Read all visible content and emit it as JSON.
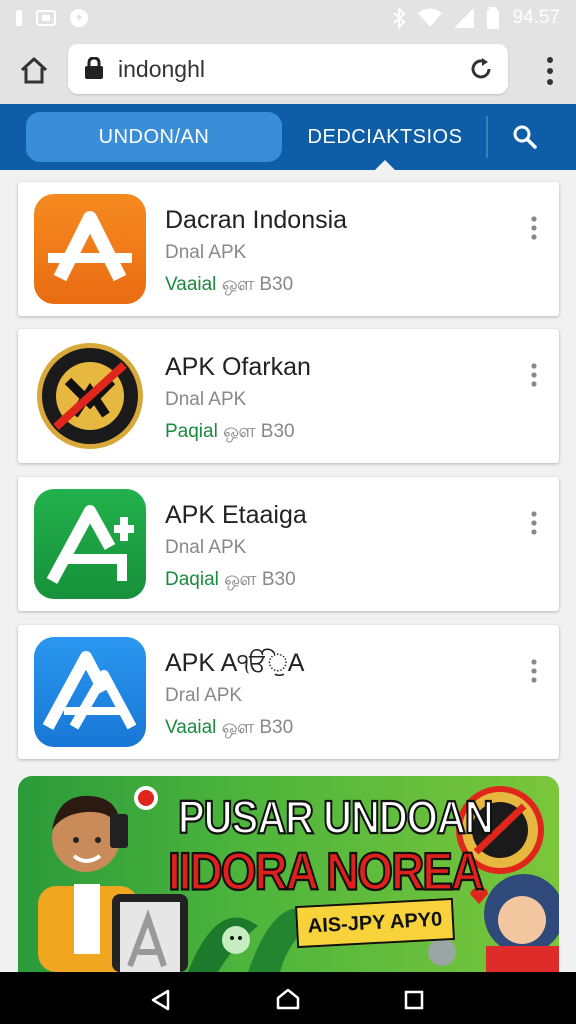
{
  "status_bar": {
    "time": "94.57"
  },
  "browser": {
    "url": "indonghl"
  },
  "tabs": {
    "active_label": "UNDON/AN",
    "second_label": "DEDCIAKTSIOS"
  },
  "apps": [
    {
      "title": "Dacran Indonsia",
      "subtitle": "Dnal APK",
      "status": "Vaaial",
      "size": "ஔ B30",
      "icon": "orange-a-icon",
      "color": "#f07818"
    },
    {
      "title": "APK Ofarkan",
      "subtitle": "Dnal APK",
      "status": "Paqial",
      "size": "ஔ B30",
      "icon": "badge-emblem-icon",
      "color": "#1a1a1a"
    },
    {
      "title": "APK Etaaiga",
      "subtitle": "Dnal APK",
      "status": "Daqial",
      "size": "ஔ B30",
      "icon": "green-a-icon",
      "color": "#1faa45"
    },
    {
      "title": "APK AੴੁA",
      "subtitle": "Dral APK",
      "status": "Vaaial",
      "size": "ஔ B30",
      "icon": "blue-a-icon",
      "color": "#1e88e5"
    }
  ],
  "banner": {
    "line1": "PUSAR UNDOAN",
    "line2": "IIDORA NOREA",
    "tag": "AIS-JPY APY0"
  }
}
